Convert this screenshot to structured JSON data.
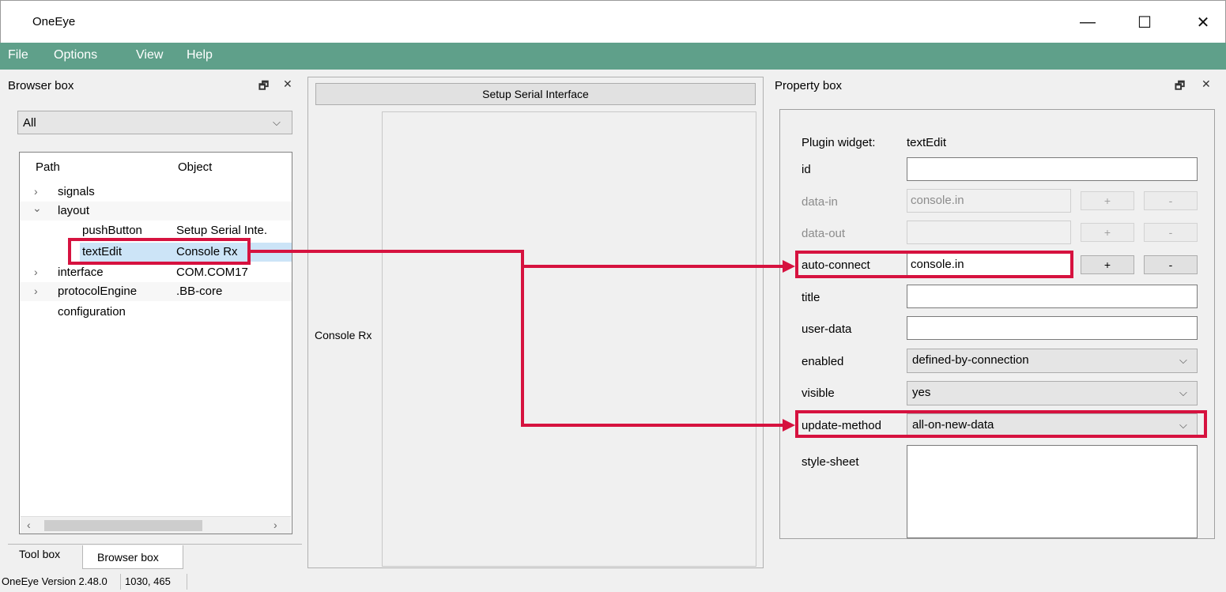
{
  "window": {
    "title": "OneEye",
    "minimize_glyph": "—",
    "maximize_glyph": "☐",
    "close_glyph": "✕"
  },
  "menu": [
    "File",
    "Options",
    "View",
    "Help"
  ],
  "browser_box": {
    "title": "Browser box",
    "filter_value": "All",
    "columns": {
      "path": "Path",
      "object": "Object"
    },
    "rows": [
      {
        "path": "signals",
        "object": "",
        "expander": "›"
      },
      {
        "path": "layout",
        "object": "",
        "expander": "⌄"
      },
      {
        "path": "pushButton",
        "object": "Setup Serial Inte.",
        "expander": ""
      },
      {
        "path": "textEdit",
        "object": "Console Rx",
        "expander": ""
      },
      {
        "path": "interface",
        "object": "COM.COM17",
        "expander": "›"
      },
      {
        "path": "protocolEngine",
        "object": ".BB-core",
        "expander": "›"
      },
      {
        "path": "configuration",
        "object": "",
        "expander": ""
      }
    ],
    "tabs": [
      "Tool box",
      "Browser box"
    ]
  },
  "center": {
    "button_label": "Setup Serial Interface",
    "console_label": "Console Rx"
  },
  "property_box": {
    "title": "Property box",
    "plugin_widget_label": "Plugin widget:",
    "plugin_widget_value": "textEdit",
    "fields": {
      "id": {
        "label": "id",
        "value": ""
      },
      "data_in": {
        "label": "data-in",
        "value": "console.in"
      },
      "data_out": {
        "label": "data-out",
        "value": ""
      },
      "auto_connect": {
        "label": "auto-connect",
        "value": "console.in"
      },
      "title": {
        "label": "title",
        "value": ""
      },
      "user_data": {
        "label": "user-data",
        "value": ""
      },
      "enabled": {
        "label": "enabled",
        "value": "defined-by-connection"
      },
      "visible": {
        "label": "visible",
        "value": "yes"
      },
      "update_method": {
        "label": "update-method",
        "value": "all-on-new-data"
      },
      "style_sheet": {
        "label": "style-sheet",
        "value": ""
      }
    },
    "plus_label": "+",
    "minus_label": "-"
  },
  "status": {
    "version": "OneEye Version 2.48.0",
    "coords": "1030, 465"
  },
  "colors": {
    "menubar": "#5fa08a",
    "highlight": "#d6123f",
    "selection": "#cce4f7"
  }
}
